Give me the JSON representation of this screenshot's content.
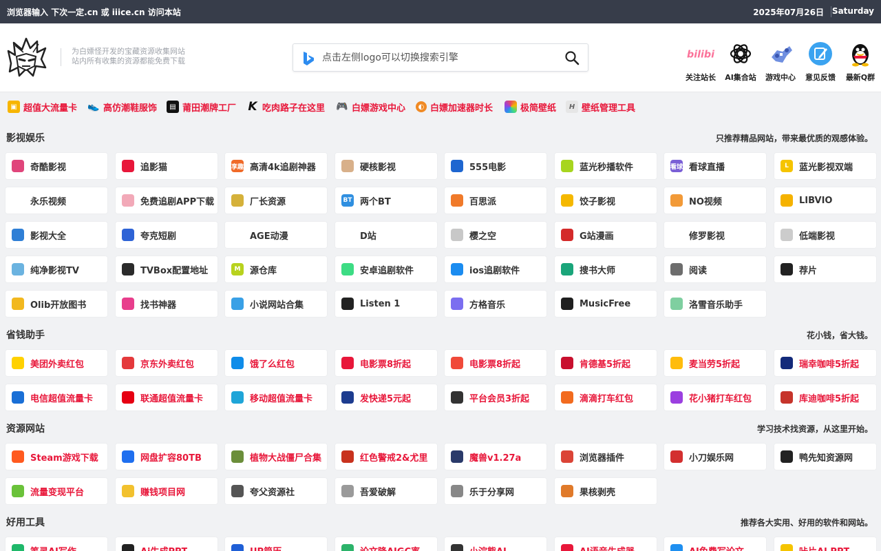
{
  "topbar": {
    "notice": "浏览器输入 下次一定.cn 或 iiice.cn 访问本站",
    "date": "2025年07月26日",
    "weekday": "Saturday"
  },
  "header": {
    "tagline_1": "为白嫖怪开发的宝藏资源收集网站",
    "tagline_2": "站内所有收集的资源都能免费下载",
    "search_placeholder": "点击左侧logo可以切换搜索引擎",
    "quick": [
      {
        "label": "关注站长",
        "icon": "bilibili-icon",
        "color": "#fb7299"
      },
      {
        "label": "AI集合站",
        "icon": "openai-icon",
        "color": "#111111"
      },
      {
        "label": "游戏中心",
        "icon": "gamepad-icon",
        "color": "#5b7bd5"
      },
      {
        "label": "意见反馈",
        "icon": "edit-icon",
        "color": "#3ba3f0"
      },
      {
        "label": "最新Q群",
        "icon": "qq-penguin-icon",
        "color": "#111111"
      }
    ]
  },
  "promo": [
    {
      "label": "超值大流量卡",
      "color": "#f7b500"
    },
    {
      "label": "高仿潮鞋服饰",
      "color": "#c23b3b"
    },
    {
      "label": "莆田潮牌工厂",
      "color": "#111111"
    },
    {
      "label": "吃肉路子在这里",
      "color": "#222222"
    },
    {
      "label": "白嫖游戏中心",
      "color": "#8c96a8"
    },
    {
      "label": "白嫖加速器时长",
      "color": "#f08a24"
    },
    {
      "label": "极简壁纸",
      "color": "#e84a5f"
    },
    {
      "label": "壁纸管理工具",
      "color": "#9aa0a6"
    }
  ],
  "sections": [
    {
      "title": "影视娱乐",
      "subtitle": "只推荐精品网站，带来最优质的观感体验。",
      "red": false,
      "items": [
        {
          "label": "奇酷影视",
          "color": "#e0457b"
        },
        {
          "label": "追影猫",
          "color": "#e8173a"
        },
        {
          "label": "高清4k追剧神器",
          "color": "#f06a28",
          "glyph": "享趣"
        },
        {
          "label": "硬核影视",
          "color": "#d8b08a"
        },
        {
          "label": "555电影",
          "color": "#1e66d0"
        },
        {
          "label": "蓝光秒播软件",
          "color": "#a7d51f"
        },
        {
          "label": "看球直播",
          "color": "#7a5fd6",
          "glyph": "看球"
        },
        {
          "label": "蓝光影视双端",
          "color": "#f5c400",
          "glyph": "LOOK"
        },
        {
          "label": "永乐视频",
          "color": "",
          "glyph": ""
        },
        {
          "label": "免费追剧APP下载",
          "color": "#f2a9b8"
        },
        {
          "label": "厂长资源",
          "color": "#d5b13a"
        },
        {
          "label": "两个BT",
          "color": "#2f8fe0",
          "glyph": "BT"
        },
        {
          "label": "百思派",
          "color": "#f07a2a"
        },
        {
          "label": "饺子影视",
          "color": "#f5b800"
        },
        {
          "label": "NO视频",
          "color": "#f29a38"
        },
        {
          "label": "LIBVIO",
          "color": "#f5b200"
        },
        {
          "label": "影视大全",
          "color": "#2f7fd6"
        },
        {
          "label": "夸克短剧",
          "color": "#2e63d6"
        },
        {
          "label": "AGE动漫",
          "color": "",
          "glyph": ""
        },
        {
          "label": "D站",
          "color": "",
          "glyph": ""
        },
        {
          "label": "樱之空",
          "color": "#c8c8c8"
        },
        {
          "label": "G站漫画",
          "color": "#d42a2a"
        },
        {
          "label": "修罗影视",
          "color": "",
          "glyph": ""
        },
        {
          "label": "低端影视",
          "color": "#cccccc"
        },
        {
          "label": "纯净影视TV",
          "color": "#6bb3e0"
        },
        {
          "label": "TVBox配置地址",
          "color": "#2b2b2b"
        },
        {
          "label": "源仓库",
          "color": "#b8d21e",
          "glyph": "M"
        },
        {
          "label": "安卓追剧软件",
          "color": "#3ddc84"
        },
        {
          "label": "ios追剧软件",
          "color": "#1b8cf0"
        },
        {
          "label": "搜书大师",
          "color": "#1aa57a"
        },
        {
          "label": "阅读",
          "color": "#6d6d6d"
        },
        {
          "label": "荐片",
          "color": "#222222"
        },
        {
          "label": "Olib开放图书",
          "color": "#f2b81f"
        },
        {
          "label": "找书神器",
          "color": "#e83e8c"
        },
        {
          "label": "小说网站合集",
          "color": "#39a0e6"
        },
        {
          "label": "Listen 1",
          "color": "#222222"
        },
        {
          "label": "方格音乐",
          "color": "#7b6ef0"
        },
        {
          "label": "MusicFree",
          "color": "#1f1f1f"
        },
        {
          "label": "洛雪音乐助手",
          "color": "#7fcfa0"
        }
      ]
    },
    {
      "title": "省钱助手",
      "subtitle": "花小钱，省大钱。",
      "red": true,
      "items": [
        {
          "label": "美团外卖红包",
          "color": "#ffd100"
        },
        {
          "label": "京东外卖红包",
          "color": "#e4393c"
        },
        {
          "label": "饿了么红包",
          "color": "#0f8ce9"
        },
        {
          "label": "电影票8折起",
          "color": "#e8173a"
        },
        {
          "label": "电影票8折起",
          "color": "#f04a3a"
        },
        {
          "label": "肯德基5折起",
          "color": "#c8102e"
        },
        {
          "label": "麦当劳5折起",
          "color": "#ffbc0d"
        },
        {
          "label": "瑞幸咖啡5折起",
          "color": "#132a7a"
        },
        {
          "label": "电信超值流量卡",
          "color": "#1a6fd6"
        },
        {
          "label": "联通超值流量卡",
          "color": "#e60012"
        },
        {
          "label": "移动超值流量卡",
          "color": "#1fa5d8"
        },
        {
          "label": "发快递5元起",
          "color": "#1d3c8f"
        },
        {
          "label": "平台会员3折起",
          "color": "#333333"
        },
        {
          "label": "滴滴打车红包",
          "color": "#f26b1f"
        },
        {
          "label": "花小猪打车红包",
          "color": "#9b3fe0"
        },
        {
          "label": "库迪咖啡5折起",
          "color": "#c6342b"
        }
      ]
    },
    {
      "title": "资源网站",
      "subtitle": "学习技术找资源，从这里开始。",
      "red": true,
      "items": [
        {
          "label": "Steam游戏下载",
          "color": "#ff5a1f"
        },
        {
          "label": "网盘扩容80TB",
          "color": "#1f6fef"
        },
        {
          "label": "植物大战僵尸合集",
          "color": "#6b8e3a"
        },
        {
          "label": "红色警戒2&尤里",
          "color": "#c8321e"
        },
        {
          "label": "魔兽v1.27a",
          "color": "#2a3a6a"
        },
        {
          "label": "浏览器插件",
          "color": "#db4437",
          "plain": true
        },
        {
          "label": "小刀娱乐网",
          "color": "#d32f2f",
          "plain": true
        },
        {
          "label": "鸭先知资源网",
          "color": "#222222",
          "plain": true
        },
        {
          "label": "流量变现平台",
          "color": "#6ac23a"
        },
        {
          "label": "赚钱项目网",
          "color": "#f2c12e"
        },
        {
          "label": "夸父资源社",
          "color": "#555555",
          "plain": true
        },
        {
          "label": "吾爱破解",
          "color": "#9a9a9a",
          "plain": true
        },
        {
          "label": "乐于分享网",
          "color": "#888888",
          "plain": true
        },
        {
          "label": "果核剥壳",
          "color": "#e07a2a",
          "plain": true
        }
      ]
    },
    {
      "title": "好用工具",
      "subtitle": "推荐各大实用、好用的软件和网站。",
      "red": true,
      "items": [
        {
          "label": "笔灵AI写作",
          "color": "#1fb86a"
        },
        {
          "label": "Ai生成PPT",
          "color": "#222222"
        },
        {
          "label": "UP简历",
          "color": "#1f5fd6"
        },
        {
          "label": "论文降AIGC率",
          "color": "#2cb36a"
        },
        {
          "label": "小浣熊AI",
          "color": "#333333"
        },
        {
          "label": "AI语音生成器",
          "color": "#e8173a"
        },
        {
          "label": "AI免费写论文",
          "color": "#1f8ff0"
        },
        {
          "label": "咔片AI PPT",
          "color": "#f5c400"
        }
      ]
    }
  ]
}
